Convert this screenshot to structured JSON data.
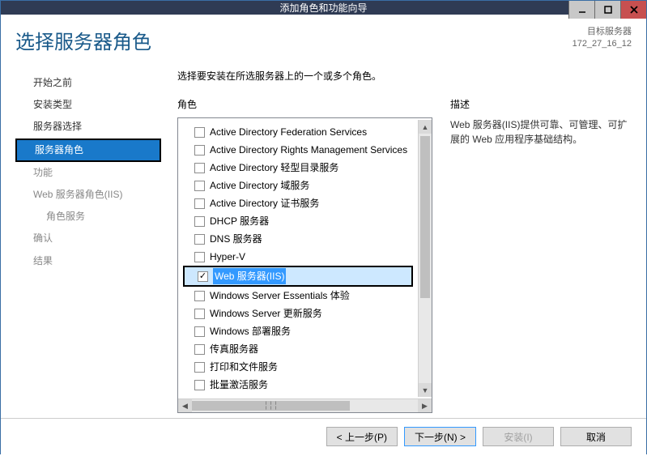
{
  "title": "添加角色和功能向导",
  "page_title": "选择服务器角色",
  "target": {
    "label": "目标服务器",
    "name": "172_27_16_12"
  },
  "nav": [
    {
      "label": "开始之前",
      "state": "completed"
    },
    {
      "label": "安装类型",
      "state": "completed"
    },
    {
      "label": "服务器选择",
      "state": "completed"
    },
    {
      "label": "服务器角色",
      "state": "active",
      "boxed": true
    },
    {
      "label": "功能",
      "state": "pending"
    },
    {
      "label": "Web 服务器角色(IIS)",
      "state": "pending"
    },
    {
      "label": "角色服务",
      "state": "pending",
      "indent": true
    },
    {
      "label": "确认",
      "state": "pending"
    },
    {
      "label": "结果",
      "state": "pending"
    }
  ],
  "instruction": "选择要安装在所选服务器上的一个或多个角色。",
  "roles_label": "角色",
  "desc_label": "描述",
  "roles": [
    {
      "label": "Active Directory Federation Services"
    },
    {
      "label": "Active Directory Rights Management Services"
    },
    {
      "label": "Active Directory 轻型目录服务"
    },
    {
      "label": "Active Directory 域服务"
    },
    {
      "label": "Active Directory 证书服务"
    },
    {
      "label": "DHCP 服务器"
    },
    {
      "label": "DNS 服务器"
    },
    {
      "label": "Hyper-V"
    },
    {
      "label": "Web 服务器(IIS)",
      "checked": true,
      "selected": true,
      "boxed": true
    },
    {
      "label": "Windows Server Essentials 体验"
    },
    {
      "label": "Windows Server 更新服务"
    },
    {
      "label": "Windows 部署服务"
    },
    {
      "label": "传真服务器"
    },
    {
      "label": "打印和文件服务"
    },
    {
      "label": "批量激活服务"
    }
  ],
  "description": "Web 服务器(IIS)提供可靠、可管理、可扩展的 Web 应用程序基础结构。",
  "buttons": {
    "previous": "< 上一步(P)",
    "next": "下一步(N) >",
    "install": "安装(I)",
    "cancel": "取消"
  }
}
